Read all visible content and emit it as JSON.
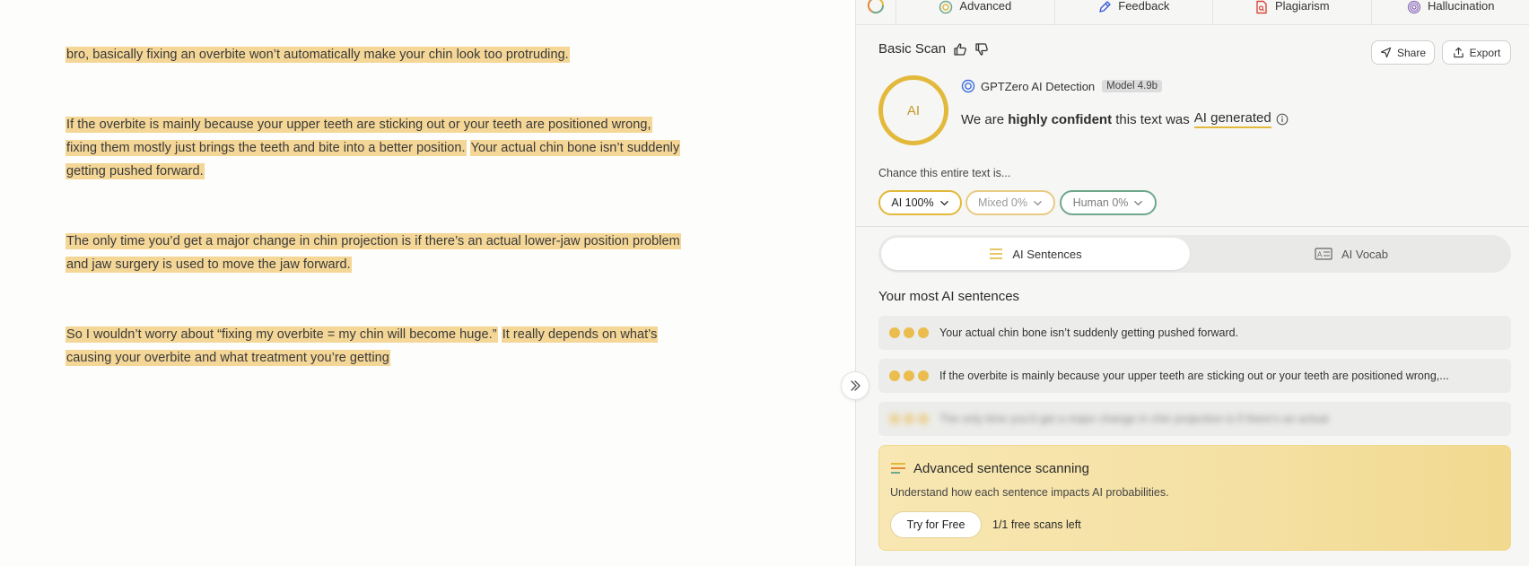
{
  "editor": {
    "paragraphs": [
      {
        "segments": [
          "bro, basically fixing an overbite won’t automatically make your chin look too protruding."
        ]
      },
      {
        "segments": [
          "If the overbite is mainly because your upper teeth are sticking out or your teeth are positioned wrong, fixing them mostly just brings the teeth and bite into a better position.",
          "Your actual chin bone isn’t suddenly getting pushed forward."
        ]
      },
      {
        "segments": [
          "The only time you’d get a major change in chin projection is if there’s an actual lower-jaw position problem and jaw surgery is used to move the jaw forward."
        ]
      },
      {
        "segments": [
          "So I wouldn’t worry about “fixing my overbite = my chin will become huge.”",
          "It really depends on what’s causing your overbite and what treatment you’re getting"
        ]
      }
    ],
    "highlight_color": "#f4d697"
  },
  "tabs": [
    {
      "label": "Advanced",
      "icon": "advanced-scan-icon"
    },
    {
      "label": "Feedback",
      "icon": "pen-icon"
    },
    {
      "label": "Plagiarism",
      "icon": "document-search-icon"
    },
    {
      "label": "Hallucination",
      "icon": "fingerprint-icon"
    }
  ],
  "header": {
    "title": "Basic Scan",
    "share_label": "Share",
    "export_label": "Export"
  },
  "result": {
    "ring_label": "AI",
    "detector_name": "GPTZero AI Detection",
    "model_badge": "Model 4.9b",
    "confidence_prefix": "We are",
    "confidence_strength": "highly confident",
    "confidence_middle": "this text was",
    "verdict": "AI generated",
    "accent_color": "#e2b93a"
  },
  "chance": {
    "label": "Chance this entire text is...",
    "ai": "AI 100%",
    "mixed": "Mixed 0%",
    "human": "Human 0%"
  },
  "segmented": {
    "sentences_label": "AI Sentences",
    "vocab_label": "AI Vocab"
  },
  "most_ai": {
    "title": "Your most AI sentences",
    "sentences": [
      "Your actual chin bone isn’t suddenly getting pushed forward.",
      "If the overbite is mainly because your upper teeth are sticking out or your teeth are positioned wrong,..."
    ],
    "blurred_sentence": "The only time you’d get a major change in chin projection is if there’s an actual"
  },
  "promo": {
    "title": "Advanced sentence scanning",
    "subtitle": "Understand how each sentence impacts AI probabilities.",
    "button": "Try for Free",
    "scans_left": "1/1 free scans left"
  }
}
